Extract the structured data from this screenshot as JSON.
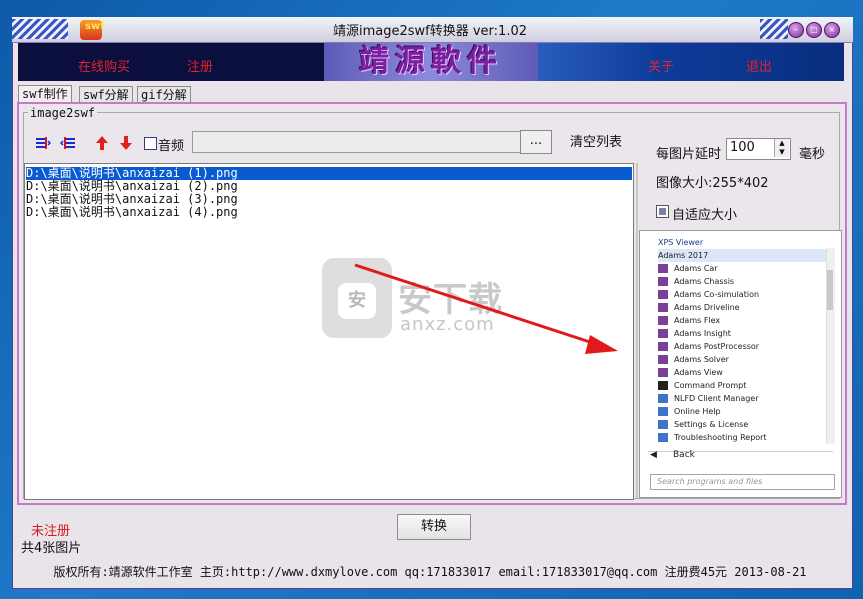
{
  "window": {
    "title": "靖源image2swf转换器 ver:1.02",
    "logo_text": "swf"
  },
  "banner": {
    "buy_online": "在线购买",
    "register": "注册",
    "brand": "靖源軟件",
    "about": "关于",
    "exit": "退出"
  },
  "tabs": [
    {
      "label": "swf制作",
      "active": true
    },
    {
      "label": "swf分解",
      "active": false
    },
    {
      "label": "gif分解",
      "active": false
    }
  ],
  "group": {
    "label": "image2swf"
  },
  "toolbar": {
    "audio_label": "音频",
    "path_value": "",
    "browse_label": "...",
    "clear_label": "清空列表"
  },
  "files": [
    "D:\\桌面\\说明书\\anxaizai (1).png",
    "D:\\桌面\\说明书\\anxaizai (2).png",
    "D:\\桌面\\说明书\\anxaizai (3).png",
    "D:\\桌面\\说明书\\anxaizai (4).png"
  ],
  "settings": {
    "delay_label": "每图片延时",
    "delay_value": "100",
    "delay_unit": "毫秒",
    "size_label": "图像大小:255*402",
    "auto_fit_label": "自适应大小",
    "auto_fit_checked": true
  },
  "preview": {
    "items": [
      "XPS Viewer",
      "Adams 2017",
      "Adams Car",
      "Adams Chassis",
      "Adams Co-simulation",
      "Adams Driveline",
      "Adams Flex",
      "Adams Insight",
      "Adams PostProcessor",
      "Adams Solver",
      "Adams View",
      "Command Prompt",
      "NLFD Client Manager",
      "Online Help",
      "Settings & License",
      "Troubleshooting Report"
    ],
    "back_label": "Back",
    "search_placeholder": "Search programs and files"
  },
  "status": {
    "unregistered": "未注册",
    "count": "共4张图片",
    "convert_label": "转换"
  },
  "footer": {
    "text": "版权所有:靖源软件工作室 主页:http://www.dxmylove.com qq:171833017 email:171833017@qq.com 注册费45元 2013-08-21"
  },
  "watermark": {
    "main": "安下载",
    "sub": "anxz.com",
    "shield": "安"
  },
  "colors": {
    "banner_link": "#e2232a",
    "selection": "#0a5ad2",
    "frame": "#c57ac7",
    "arrow": "#e01a1a"
  }
}
